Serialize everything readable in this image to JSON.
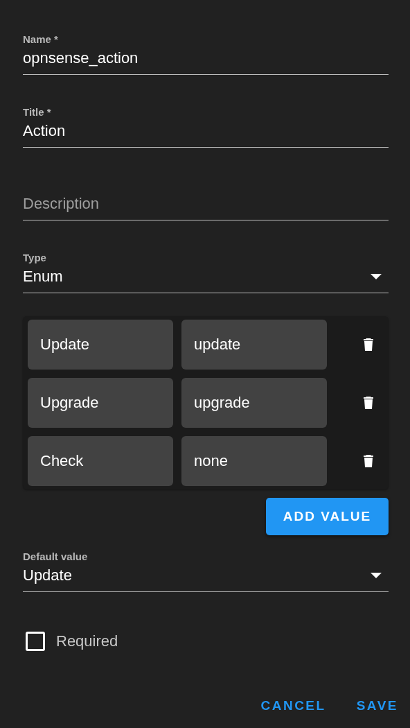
{
  "fields": [
    {
      "kind": "text",
      "label": "Name *",
      "value": "opnsense_action"
    },
    {
      "kind": "text",
      "label": "Title *",
      "value": "Action"
    },
    {
      "kind": "text",
      "placeholder": "Description"
    },
    {
      "kind": "select",
      "label": "Type",
      "value": "Enum"
    }
  ],
  "enum_values": [
    {
      "label": "Update",
      "value": "update"
    },
    {
      "label": "Upgrade",
      "value": "upgrade"
    },
    {
      "label": "Check",
      "value": "none"
    }
  ],
  "add_button": "ADD VALUE",
  "default_field": {
    "kind": "select",
    "label": "Default value",
    "value": "Update"
  },
  "required": {
    "label": "Required",
    "checked": false
  },
  "actions": [
    "CANCEL",
    "SAVE"
  ]
}
